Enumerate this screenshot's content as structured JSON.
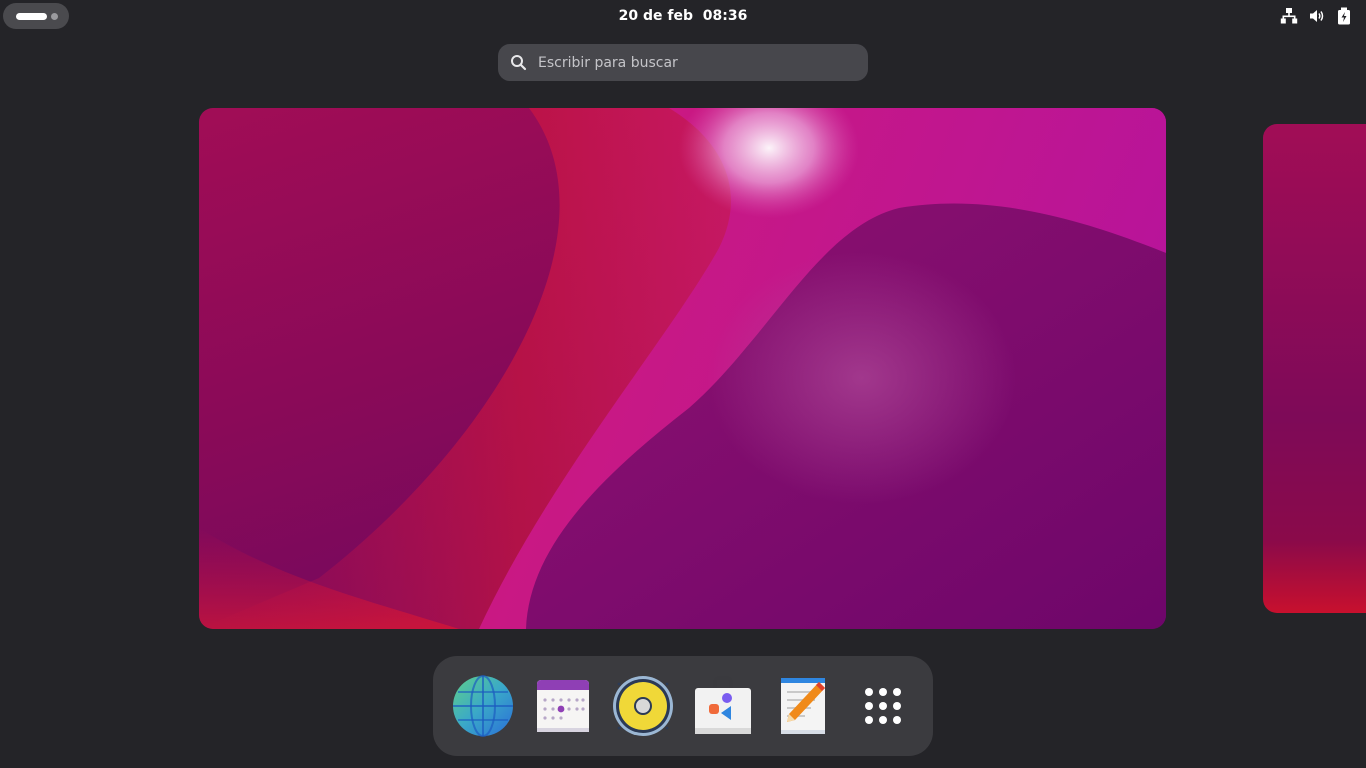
{
  "topbar": {
    "clock": "20 de feb  08:36",
    "activities_icon": "workspace-indicator-icon",
    "tray_icons": [
      "network-wired-icon",
      "volume-high-icon",
      "battery-charging-icon"
    ]
  },
  "search": {
    "placeholder": "Escribir para buscar",
    "value": "",
    "icon": "search-icon"
  },
  "workspaces": [
    {
      "name": "workspace-1",
      "active": true
    },
    {
      "name": "workspace-2",
      "active": false
    }
  ],
  "dash": {
    "apps": [
      {
        "icon": "web-browser-globe-icon"
      },
      {
        "icon": "calendar-icon"
      },
      {
        "icon": "music-player-speaker-icon"
      },
      {
        "icon": "software-store-bag-icon"
      },
      {
        "icon": "text-editor-icon"
      },
      {
        "icon": "show-applications-grid-icon"
      }
    ]
  },
  "colors": {
    "background": "#242428",
    "dash": "#3b3b3f",
    "search": "#47474c",
    "wallpaper_red": "#c3154f",
    "wallpaper_purple": "#780a6e"
  }
}
